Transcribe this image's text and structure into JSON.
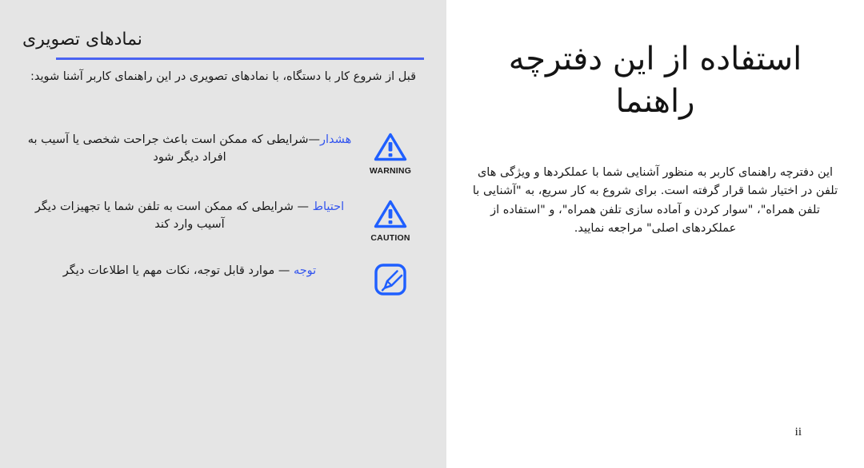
{
  "document": {
    "page_number": "ii"
  },
  "left_panel": {
    "background_color": "#e5e5e5",
    "title": "نمادهای تصویری",
    "divider_color": "#4a63f2",
    "intro": "قبل از شروع کار با دستگاه، با نمادهای تصویری در این راهنمای کاربر آشنا شوید:",
    "rows": [
      {
        "icon_name": "warning-triangle-icon",
        "icon_caption": "WARNING",
        "icon_color": "#1f5fff",
        "keyword": "هشدار",
        "separator": "—",
        "description": "شرایطی که ممکن است باعث جراحت شخصی یا آسیب به افراد دیگر شود"
      },
      {
        "icon_name": "caution-triangle-icon",
        "icon_caption": "CAUTION",
        "icon_color": "#1f5fff",
        "keyword": "احتیاط",
        "separator": " — ",
        "description": "شرایطی که ممکن است به تلفن شما یا تجهیزات دیگر آسیب وارد کند"
      },
      {
        "icon_name": "note-pen-icon",
        "icon_caption": "",
        "icon_color": "#1f5fff",
        "keyword": "توجه",
        "separator": " — ",
        "description": "موارد قابل توجه، نکات مهم یا اطلاعات دیگر"
      }
    ]
  },
  "right_panel": {
    "background_color": "#ffffff",
    "title": "استفاده از این دفترچه راهنما",
    "body": "این دفترچه راهنمای کاربر به منظور آشنایی شما با عملکردها و ویژگی های تلفن در اختیار شما قرار گرفته است. برای شروع به کار سریع، به \"آشنایی با تلفن همراه\"، \"سوار کردن و آماده سازی تلفن همراه\"، و \"استفاده از عملکردهای اصلی\" مراجعه نمایید."
  }
}
